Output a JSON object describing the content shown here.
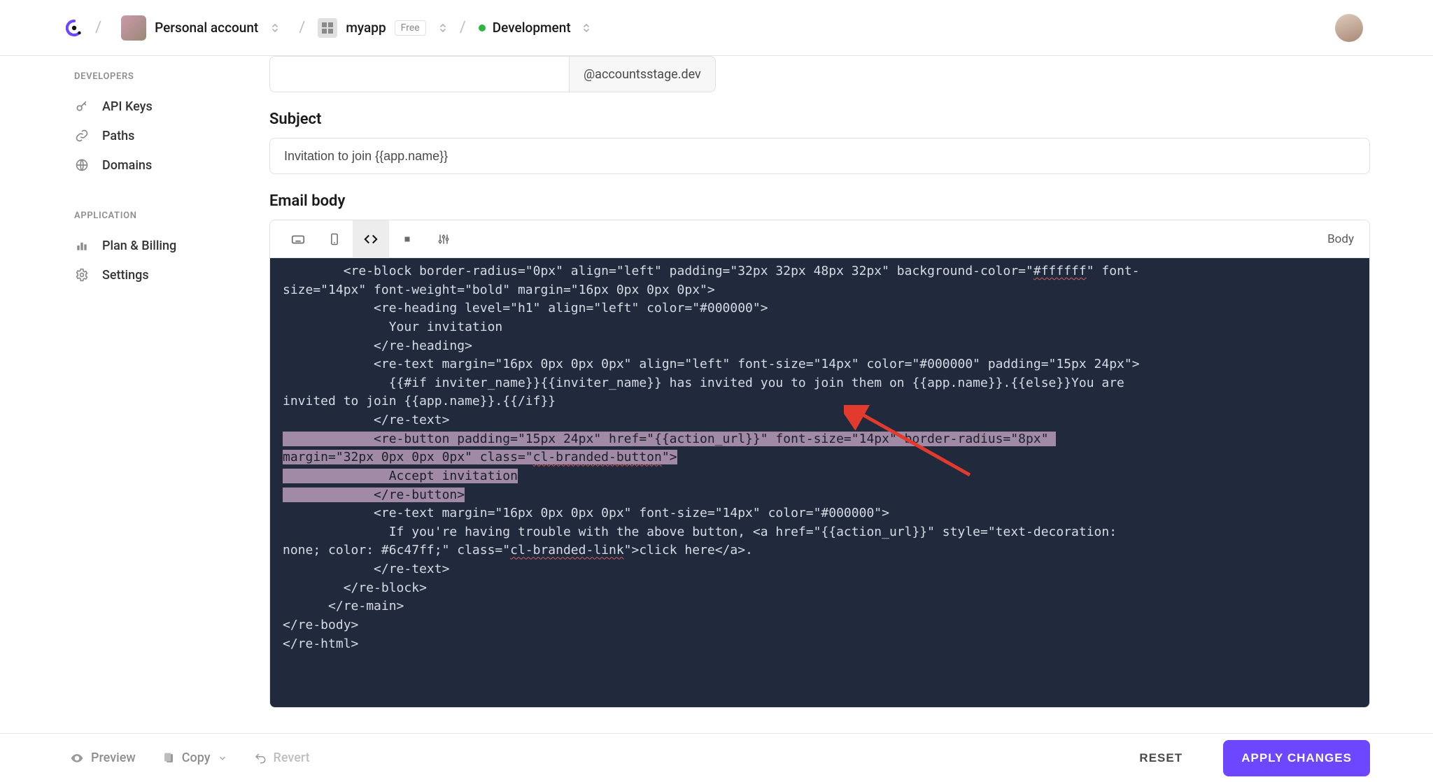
{
  "header": {
    "account_label": "Personal account",
    "app_name": "myapp",
    "app_badge": "Free",
    "environment": "Development"
  },
  "sidebar": {
    "sections": [
      {
        "label": "DEVELOPERS",
        "items": [
          {
            "id": "api-keys",
            "label": "API Keys",
            "icon": "key-icon"
          },
          {
            "id": "paths",
            "label": "Paths",
            "icon": "link-icon"
          },
          {
            "id": "domains",
            "label": "Domains",
            "icon": "globe-icon"
          }
        ]
      },
      {
        "label": "APPLICATION",
        "items": [
          {
            "id": "plan-billing",
            "label": "Plan & Billing",
            "icon": "bars-icon"
          },
          {
            "id": "settings",
            "label": "Settings",
            "icon": "gear-icon"
          }
        ]
      }
    ]
  },
  "form": {
    "from_suffix": "@accountsstage.dev",
    "subject_label": "Subject",
    "subject_value": "Invitation to join {{app.name}}",
    "body_label": "Email body",
    "toolbar_right": "Body"
  },
  "code": {
    "l1a": "        <re-block border-radius=\"0px\" align=\"left\" padding=\"32px 32px 48px 32px\" background-color=\"",
    "l1b": "#ffffff",
    "l1c": "\" font-",
    "l2": "size=\"14px\" font-weight=\"bold\" margin=\"16px 0px 0px 0px\">",
    "l3": "            <re-heading level=\"h1\" align=\"left\" color=\"#000000\">",
    "l4": "              Your invitation",
    "l5": "            </re-heading>",
    "l6": "            <re-text margin=\"16px 0px 0px 0px\" align=\"left\" font-size=\"14px\" color=\"#000000\" padding=\"15px 24px\">",
    "l7": "              {{#if inviter_name}}{{inviter_name}} has invited you to join them on {{app.name}}.{{else}}You are",
    "l8": "invited to join {{app.name}}.{{/if}}",
    "l9": "            </re-text>",
    "l10a": "            <re-button padding=\"15px 24px\" href=\"{{action_url}}\" font-size=\"14px\" border-radius=\"8px\"",
    "l11a": "margin=\"32px 0px 0px 0px\" class=\"",
    "l11b": "cl-branded-button",
    "l11c": "\">",
    "l12a": "              Accept invitation",
    "l13a": "            </re-button>",
    "l14": "            <re-text margin=\"16px 0px 0px 0px\" font-size=\"14px\" color=\"#000000\">",
    "l15": "              If you're having trouble with the above button, <a href=\"{{action_url}}\" style=\"text-decoration:",
    "l16a": "none; color: #6c47ff;\" class=\"",
    "l16b": "cl-branded-link",
    "l16c": "\">click here</a>.",
    "l17": "            </re-text>",
    "l18": "        </re-block>",
    "l19": "      </re-main>",
    "l20": "</re-body>",
    "l21": "</re-html>"
  },
  "footer": {
    "preview": "Preview",
    "copy": "Copy",
    "revert": "Revert",
    "reset": "RESET",
    "apply": "APPLY CHANGES"
  }
}
